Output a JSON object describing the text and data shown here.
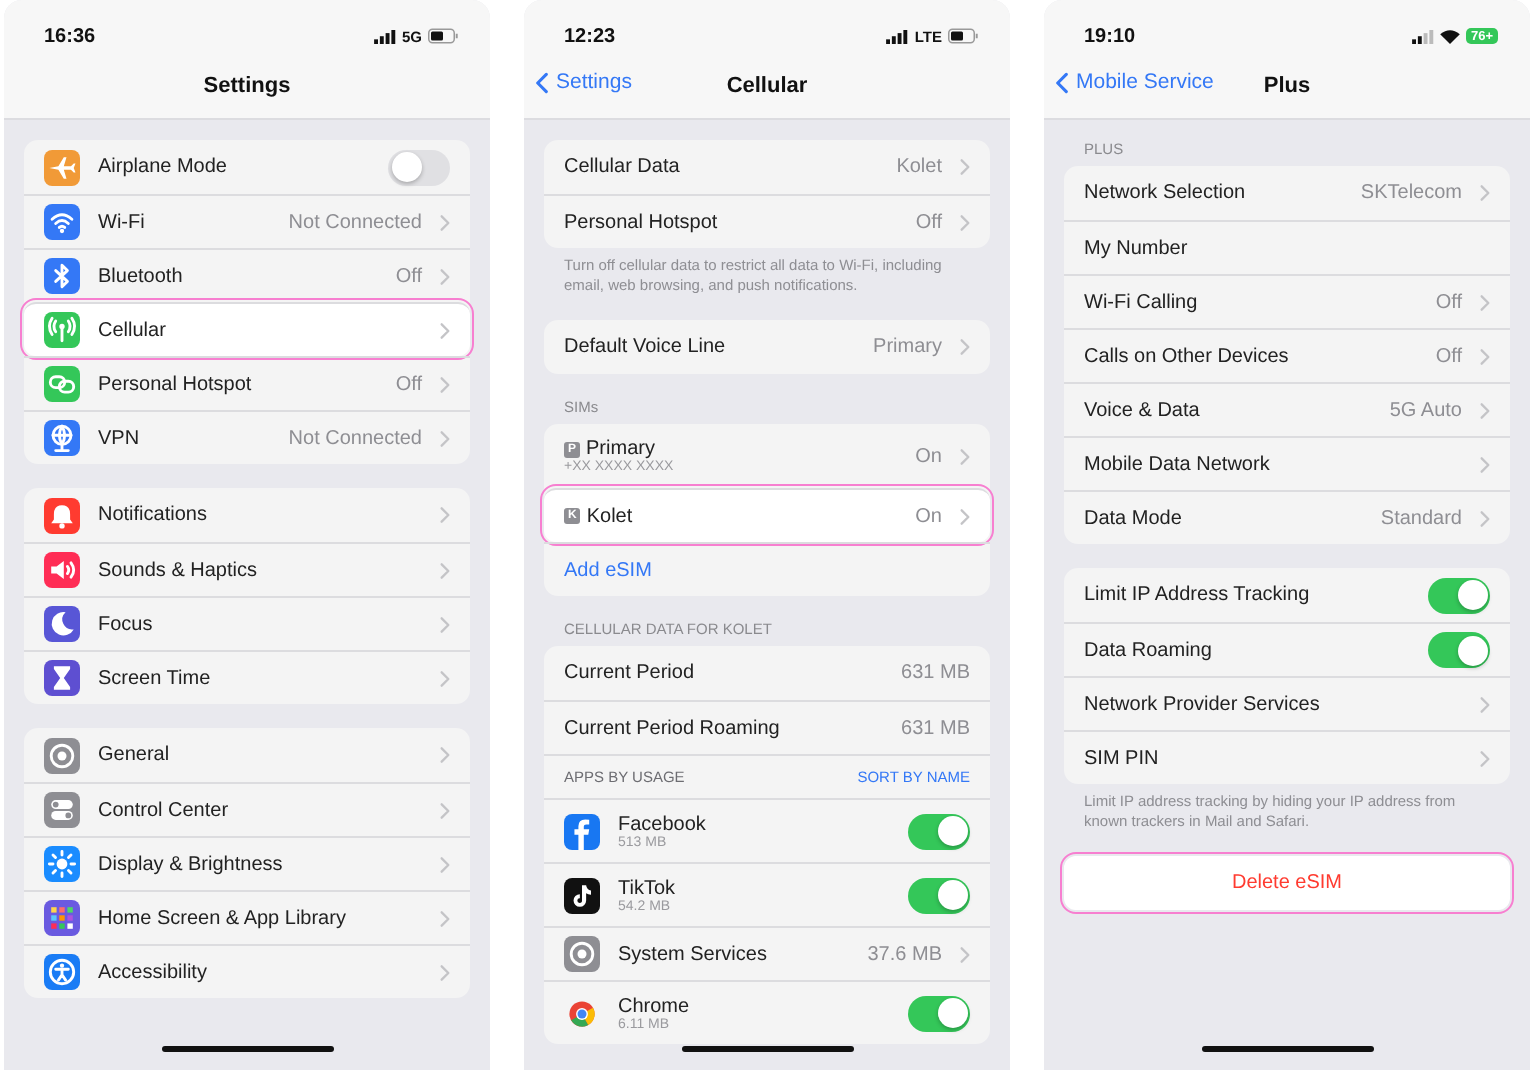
{
  "screens": [
    {
      "status": {
        "time": "16:36",
        "network": "5G"
      },
      "nav": {
        "title": "Settings"
      },
      "sections": [
        {
          "rows": [
            {
              "kind": "toggle",
              "label": "Airplane Mode",
              "on": false,
              "color": "#f19a37",
              "highlighted": false
            },
            {
              "kind": "nav",
              "label": "Wi-Fi",
              "value": "Not Connected",
              "color": "#3478f6",
              "highlighted": false
            },
            {
              "kind": "nav",
              "label": "Bluetooth",
              "value": "Off",
              "color": "#3478f6",
              "highlighted": false
            },
            {
              "kind": "nav",
              "label": "Cellular",
              "color": "#34c759",
              "highlighted": true
            },
            {
              "kind": "nav",
              "label": "Personal Hotspot",
              "value": "Off",
              "color": "#34c759",
              "highlighted": false
            },
            {
              "kind": "nav",
              "label": "VPN",
              "value": "Not Connected",
              "color": "#3478f6",
              "highlighted": false
            }
          ]
        },
        {
          "rows": [
            {
              "kind": "nav",
              "label": "Notifications",
              "color": "#ff3b30"
            },
            {
              "kind": "nav",
              "label": "Sounds & Haptics",
              "color": "#ff2d55"
            },
            {
              "kind": "nav",
              "label": "Focus",
              "color": "#5856d6"
            },
            {
              "kind": "nav",
              "label": "Screen Time",
              "color": "#5e4fd1"
            }
          ]
        },
        {
          "rows": [
            {
              "kind": "nav",
              "label": "General",
              "color": "#8e8e93"
            },
            {
              "kind": "nav",
              "label": "Control Center",
              "color": "#8e8e93"
            },
            {
              "kind": "nav",
              "label": "Display & Brightness",
              "color": "#1a8cff"
            },
            {
              "kind": "nav",
              "label": "Home Screen & App Library",
              "color": "#6a5ae0"
            },
            {
              "kind": "nav",
              "label": "Accessibility",
              "color": "#1a7cf5"
            }
          ]
        }
      ]
    },
    {
      "status": {
        "time": "12:23",
        "network": "LTE"
      },
      "nav": {
        "back": "Settings",
        "title": "Cellular"
      },
      "sections": [
        {
          "rows": [
            {
              "kind": "nav",
              "label": "Cellular Data",
              "value": "Kolet"
            },
            {
              "kind": "nav",
              "label": "Personal Hotspot",
              "value": "Off"
            }
          ],
          "footer": "Turn off cellular data to restrict all data to Wi-Fi, including email, web browsing, and push notifications."
        },
        {
          "rows": [
            {
              "kind": "nav",
              "label": "Default Voice Line",
              "value": "Primary"
            }
          ]
        },
        {
          "header": "SIMs",
          "rows": [
            {
              "kind": "sim",
              "badge": "P",
              "label": "Primary",
              "sub": "+XX XXXX XXXX",
              "value": "On",
              "highlighted": false
            },
            {
              "kind": "sim",
              "badge": "K",
              "label": "Kolet",
              "value": "On",
              "highlighted": true
            },
            {
              "kind": "link",
              "label": "Add eSIM",
              "highlighted": false
            }
          ]
        },
        {
          "header": "CELLULAR DATA FOR KOLET",
          "rows": [
            {
              "kind": "info",
              "label": "Current Period",
              "value": "631 MB"
            },
            {
              "kind": "info",
              "label": "Current Period Roaming",
              "value": "631 MB"
            },
            {
              "kind": "subheader",
              "label": "APPS BY USAGE",
              "action": "SORT BY NAME"
            },
            {
              "kind": "app",
              "label": "Facebook",
              "sub": "513 MB",
              "on": true
            },
            {
              "kind": "app",
              "label": "TikTok",
              "sub": "54.2 MB",
              "on": true
            },
            {
              "kind": "app-nav",
              "label": "System Services",
              "value": "37.6 MB"
            },
            {
              "kind": "app",
              "label": "Chrome",
              "sub": "6.11 MB",
              "on": true
            }
          ]
        }
      ]
    },
    {
      "status": {
        "time": "19:10",
        "battery": "76+"
      },
      "nav": {
        "back": "Mobile Service",
        "title": "Plus"
      },
      "sections": [
        {
          "header": "PLUS",
          "rows": [
            {
              "kind": "nav",
              "label": "Network Selection",
              "value": "SKTelecom"
            },
            {
              "kind": "info",
              "label": "My Number"
            },
            {
              "kind": "nav",
              "label": "Wi-Fi Calling",
              "value": "Off"
            },
            {
              "kind": "nav",
              "label": "Calls on Other Devices",
              "value": "Off"
            },
            {
              "kind": "nav",
              "label": "Voice & Data",
              "value": "5G Auto"
            },
            {
              "kind": "nav",
              "label": "Mobile Data Network"
            },
            {
              "kind": "nav",
              "label": "Data Mode",
              "value": "Standard"
            }
          ]
        },
        {
          "rows": [
            {
              "kind": "toggle",
              "label": "Limit IP Address Tracking",
              "on": true
            },
            {
              "kind": "toggle",
              "label": "Data Roaming",
              "on": true
            },
            {
              "kind": "nav",
              "label": "Network Provider Services"
            },
            {
              "kind": "nav",
              "label": "SIM PIN"
            }
          ],
          "footer": "Limit IP address tracking by hiding your IP address from known trackers in Mail and Safari."
        },
        {
          "rows": [
            {
              "kind": "button",
              "label": "Delete eSIM",
              "highlighted": true
            }
          ]
        }
      ]
    }
  ]
}
